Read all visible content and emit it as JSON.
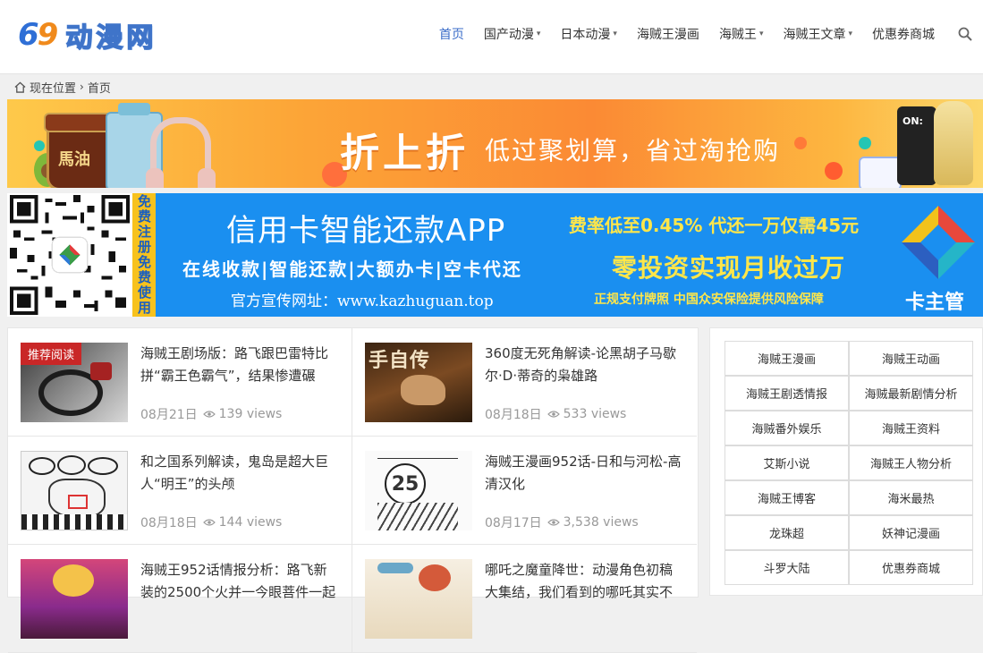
{
  "logo": {
    "num_a": "6",
    "num_b": "9",
    "name": "动漫网"
  },
  "nav": [
    {
      "label": "首页",
      "active": true,
      "dropdown": false
    },
    {
      "label": "国产动漫",
      "active": false,
      "dropdown": true
    },
    {
      "label": "日本动漫",
      "active": false,
      "dropdown": true
    },
    {
      "label": "海贼王漫画",
      "active": false,
      "dropdown": false
    },
    {
      "label": "海贼王",
      "active": false,
      "dropdown": true
    },
    {
      "label": "海贼王文章",
      "active": false,
      "dropdown": true
    },
    {
      "label": "优惠券商城",
      "active": false,
      "dropdown": false
    }
  ],
  "breadcrumb": {
    "location": "现在位置",
    "current": "首页"
  },
  "banner1": {
    "main": "折上折",
    "sub": "低过聚划算，省过淘抢购",
    "jar_label": "馬油",
    "bottle_label": "ON:"
  },
  "banner2": {
    "side": "免费注册免费使用",
    "title": "信用卡智能还款APP",
    "features": "在线收款|智能还款|大额办卡|空卡代还",
    "url": "官方宣传网址：www.kazhuguan.top",
    "rate": "费率低至0.45% 代还一万仅需45元",
    "headline": "零投资实现月收过万",
    "cert": "正规支付牌照  中国众安保险提供风险保障",
    "brand": "卡主管"
  },
  "posts": [
    {
      "title": "海贼王剧场版：路飞跟巴雷特比拼“霸王色霸气”，结果惨遭碾",
      "date": "08月21日",
      "views": "139 views",
      "badge": "推荐阅读"
    },
    {
      "title": "360度无死角解读-论黑胡子马歇尔·D·蒂奇的枭雄路",
      "date": "08月18日",
      "views": "533 views",
      "thumb_text": "手自传"
    },
    {
      "title": "和之国系列解读，鬼岛是超大巨人“明王”的头颅",
      "date": "08月18日",
      "views": "144 views"
    },
    {
      "title": "海贼王漫画952话-日和与河松-高清汉化",
      "date": "08月17日",
      "views": "3,538 views",
      "thumb_num": "25"
    },
    {
      "title": "海贼王952话情报分析：路飞新装的2500个火并一今眼菩件一起",
      "date": "",
      "views": ""
    },
    {
      "title": "哪吒之魔童降世：动漫角色初稿大集结，我们看到的哪吒其实不",
      "date": "",
      "views": ""
    }
  ],
  "tags": [
    "海贼王漫画",
    "海贼王动画",
    "海贼王剧透情报",
    "海贼最新剧情分析",
    "海贼番外娱乐",
    "海贼王资料",
    "艾斯小说",
    "海贼王人物分析",
    "海贼王博客",
    "海米最热",
    "龙珠超",
    "妖神记漫画",
    "斗罗大陆",
    "优惠券商城"
  ],
  "colors": {
    "accent": "#3b6dc9",
    "badge": "#c92727",
    "banner_blue": "#1a8ff0",
    "banner_yellow": "#ffe64a"
  },
  "icons": {
    "search": "search-icon",
    "home": "home-icon",
    "views": "eye-icon",
    "chevron": "chevron-down-icon"
  }
}
